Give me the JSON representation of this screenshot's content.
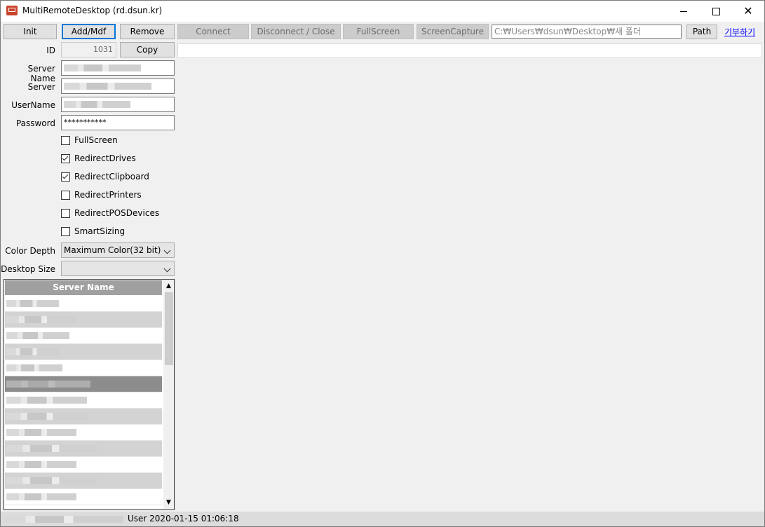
{
  "window": {
    "title": "MultiRemoteDesktop (rd.dsun.kr)"
  },
  "toolbar": {
    "init": "Init",
    "add_mdf": "Add/Mdf",
    "remove": "Remove",
    "connect": "Connect",
    "disconnect": "Disconnect / Close",
    "fullscreen": "FullScreen",
    "screencapture": "ScreenCapture",
    "path_value": "C:₩Users₩dsun₩Desktop₩새 폴더",
    "path_button": "Path",
    "donate": "기부하기"
  },
  "form": {
    "id_label": "ID",
    "id_value": "1031",
    "copy_button": "Copy",
    "server_name_label": "Server Name",
    "server_label": "Server",
    "username_label": "UserName",
    "password_label": "Password",
    "password_value": "***********",
    "color_depth_label": "Color Depth",
    "color_depth_value": "Maximum Color(32 bit)",
    "desktop_size_label": "Desktop Size",
    "desktop_size_value": ""
  },
  "options": [
    {
      "label": "FullScreen",
      "checked": false
    },
    {
      "label": "RedirectDrives",
      "checked": true
    },
    {
      "label": "RedirectClipboard",
      "checked": true
    },
    {
      "label": "RedirectPrinters",
      "checked": false
    },
    {
      "label": "RedirectPOSDevices",
      "checked": false
    },
    {
      "label": "SmartSizing",
      "checked": false
    }
  ],
  "server_list": {
    "header": "Server Name",
    "row_count_visible": 13,
    "selected_row": 5
  },
  "statusbar": {
    "text": "User  2020-01-15 01:06:18"
  },
  "icons": [
    "app-icon",
    "minimize-icon",
    "maximize-icon",
    "close-icon",
    "checkbox-icon",
    "chevron-down-icon",
    "scroll-up-icon",
    "scroll-down-icon"
  ],
  "colors": {
    "accent": "#0078d7",
    "link": "#0000ff",
    "list_header": "#a0a0a0",
    "list_selected": "#8c8c8c"
  }
}
